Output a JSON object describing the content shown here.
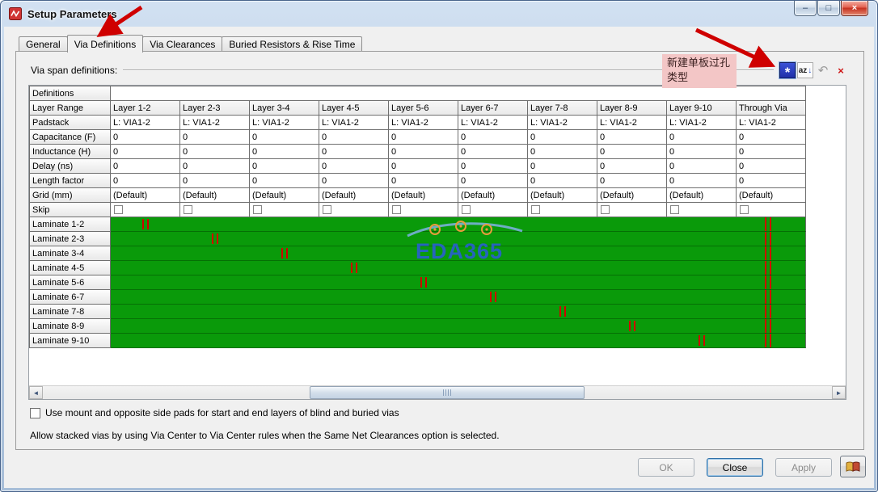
{
  "window": {
    "title": "Setup Parameters",
    "controls": {
      "minimize": "–",
      "maximize": "□",
      "close": "×"
    }
  },
  "tabs": [
    {
      "label": "General",
      "active": false
    },
    {
      "label": "Via Definitions",
      "active": true
    },
    {
      "label": "Via Clearances",
      "active": false
    },
    {
      "label": "Buried Resistors & Rise Time",
      "active": false
    }
  ],
  "via_span": {
    "label": "Via span definitions:"
  },
  "toolbar": {
    "new_via": "*",
    "sort": "az",
    "sort_arrow": "↓",
    "undo": "↶",
    "delete": "×"
  },
  "annotation": {
    "line1": "新建单板过孔",
    "line2": "类型"
  },
  "table": {
    "group_label": "Definitions",
    "columns": [
      "Layer 1-2",
      "Layer 2-3",
      "Layer 3-4",
      "Layer 4-5",
      "Layer 5-6",
      "Layer 6-7",
      "Layer 7-8",
      "Layer 8-9",
      "Layer 9-10",
      "Through Via"
    ],
    "rows": [
      {
        "label": "Layer Range",
        "type": "header",
        "values": [
          "Layer 1-2",
          "Layer 2-3",
          "Layer 3-4",
          "Layer 4-5",
          "Layer 5-6",
          "Layer 6-7",
          "Layer 7-8",
          "Layer 8-9",
          "Layer 9-10",
          "Through Via"
        ]
      },
      {
        "label": "Padstack",
        "type": "text",
        "values": [
          "L: VIA1-2",
          "L: VIA1-2",
          "L: VIA1-2",
          "L: VIA1-2",
          "L: VIA1-2",
          "L: VIA1-2",
          "L: VIA1-2",
          "L: VIA1-2",
          "L: VIA1-2",
          "L: VIA1-2"
        ]
      },
      {
        "label": "Capacitance (F)",
        "type": "text",
        "values": [
          "0",
          "0",
          "0",
          "0",
          "0",
          "0",
          "0",
          "0",
          "0",
          "0"
        ]
      },
      {
        "label": "Inductance (H)",
        "type": "text",
        "values": [
          "0",
          "0",
          "0",
          "0",
          "0",
          "0",
          "0",
          "0",
          "0",
          "0"
        ]
      },
      {
        "label": "Delay (ns)",
        "type": "text",
        "values": [
          "0",
          "0",
          "0",
          "0",
          "0",
          "0",
          "0",
          "0",
          "0",
          "0"
        ]
      },
      {
        "label": "Length factor",
        "type": "text",
        "values": [
          "0",
          "0",
          "0",
          "0",
          "0",
          "0",
          "0",
          "0",
          "0",
          "0"
        ]
      },
      {
        "label": "Grid (mm)",
        "type": "text",
        "values": [
          "(Default)",
          "(Default)",
          "(Default)",
          "(Default)",
          "(Default)",
          "(Default)",
          "(Default)",
          "(Default)",
          "(Default)",
          "(Default)"
        ]
      },
      {
        "label": "Skip",
        "type": "checkbox",
        "values": [
          false,
          false,
          false,
          false,
          false,
          false,
          false,
          false,
          false,
          false
        ]
      }
    ],
    "matrix": {
      "rows": [
        {
          "label": "Laminate 1-2",
          "mark_col": 0
        },
        {
          "label": "Laminate 2-3",
          "mark_col": 1
        },
        {
          "label": "Laminate 3-4",
          "mark_col": 2
        },
        {
          "label": "Laminate 4-5",
          "mark_col": 3
        },
        {
          "label": "Laminate 5-6",
          "mark_col": 4
        },
        {
          "label": "Laminate 6-7",
          "mark_col": 5
        },
        {
          "label": "Laminate 7-8",
          "mark_col": 6
        },
        {
          "label": "Laminate 8-9",
          "mark_col": 7
        },
        {
          "label": "Laminate 9-10",
          "mark_col": 8
        }
      ],
      "through_col": 9,
      "colors": {
        "green": "#0a9a0a",
        "mark": "#cf0000"
      }
    }
  },
  "scrollbar": {
    "left": "◄",
    "right": "►"
  },
  "watermark": {
    "text": "EDA365"
  },
  "footer": {
    "pads_checkbox": {
      "label": "Use mount and opposite side pads for start and end layers of blind and buried vias",
      "checked": false
    },
    "note": "Allow stacked vias by using Via Center to Via Center rules when the Same Net Clearances option is selected.",
    "buttons": [
      {
        "label": "OK",
        "enabled": false
      },
      {
        "label": "Close",
        "enabled": true,
        "focused": true
      },
      {
        "label": "Apply",
        "enabled": false
      }
    ]
  }
}
